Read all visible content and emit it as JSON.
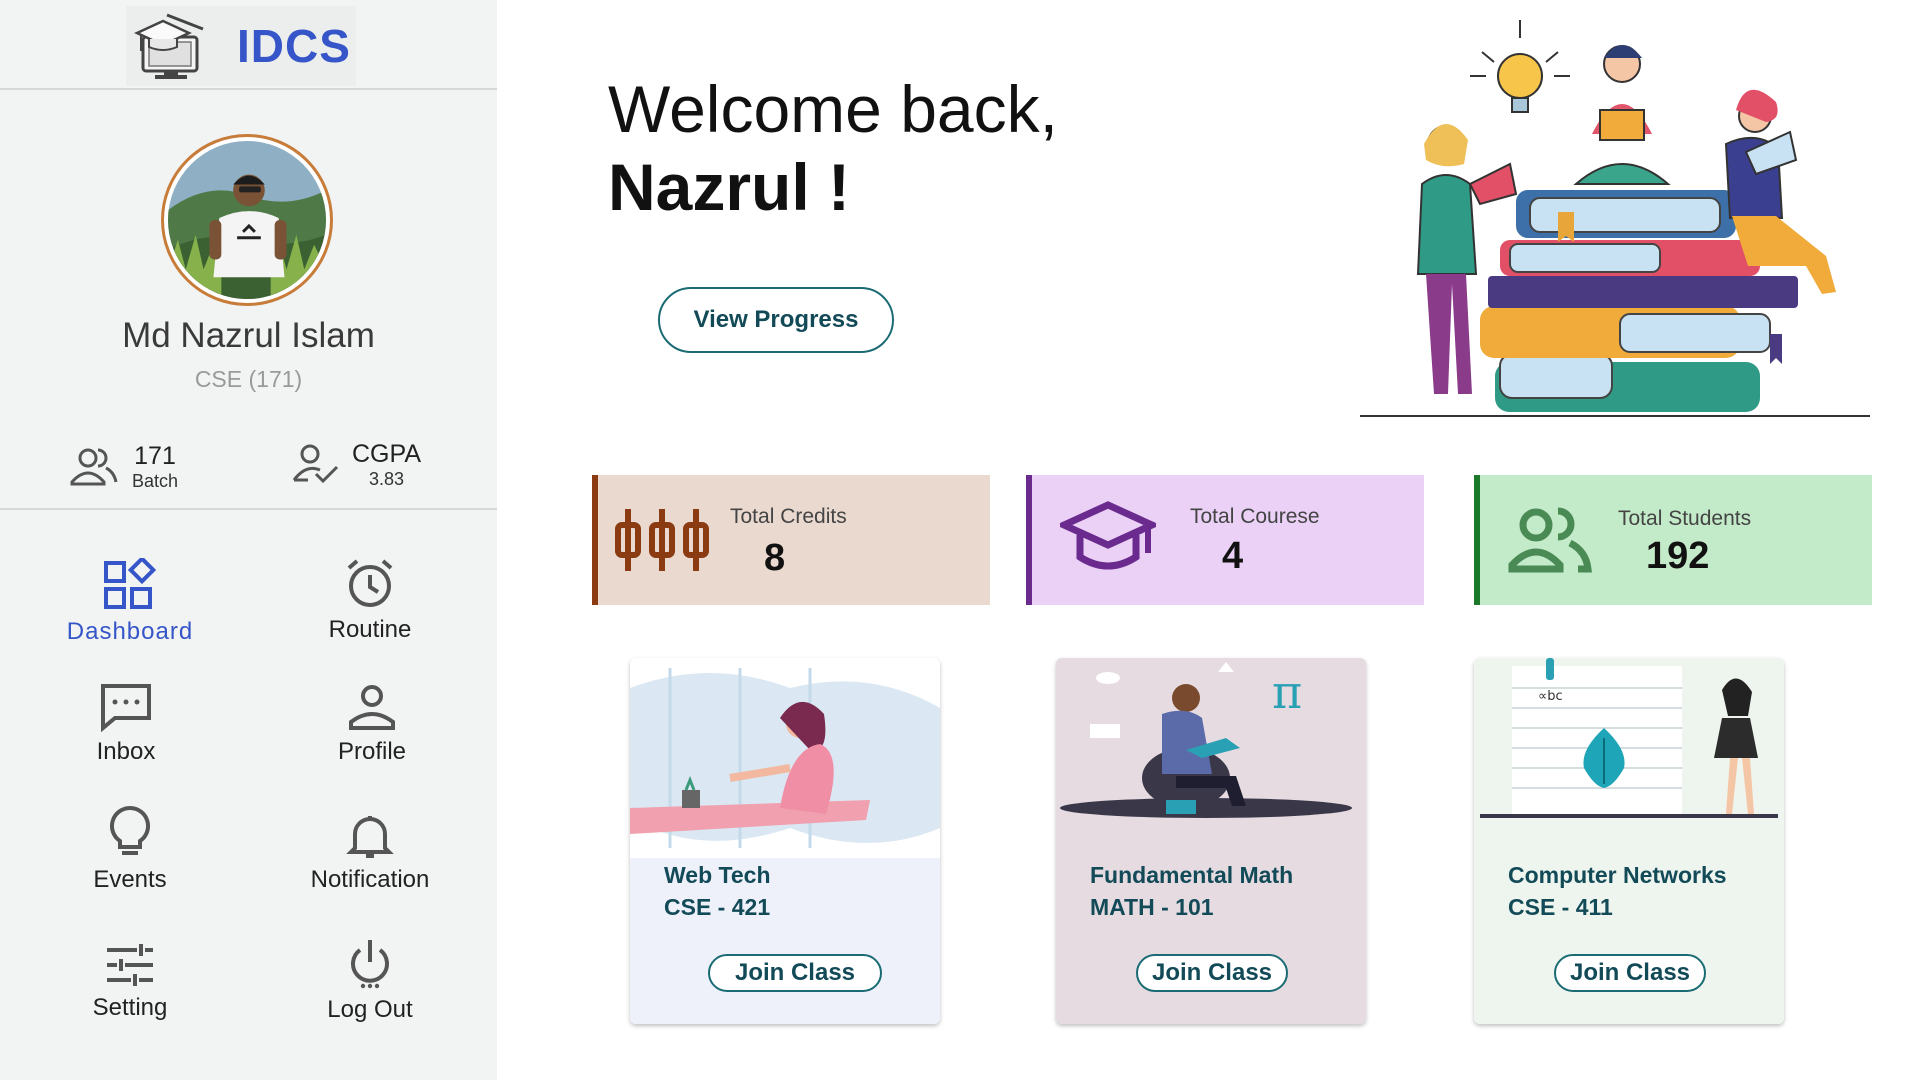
{
  "brand": {
    "name": "IDCS"
  },
  "user": {
    "name": "Md Nazrul Islam",
    "dept": "CSE (171)"
  },
  "stats": {
    "batch_value": "171",
    "batch_label": "Batch",
    "cgpa_label": "CGPA",
    "cgpa_value": "3.83"
  },
  "nav": [
    {
      "label": "Dashboard",
      "icon": "dashboard-icon",
      "active": true
    },
    {
      "label": "Routine",
      "icon": "alarm-clock-icon"
    },
    {
      "label": "Inbox",
      "icon": "chat-icon"
    },
    {
      "label": "Profile",
      "icon": "person-icon"
    },
    {
      "label": "Events",
      "icon": "lightbulb-icon"
    },
    {
      "label": "Notification",
      "icon": "bell-icon"
    },
    {
      "label": "Setting",
      "icon": "sliders-icon"
    },
    {
      "label": "Log Out",
      "icon": "power-icon"
    }
  ],
  "welcome": {
    "line1": "Welcome back,",
    "line2": "Nazrul !"
  },
  "progress_button": "View Progress",
  "summary": [
    {
      "title": "Total  Credits",
      "value": "8",
      "color": "#ead9cf",
      "accent": "#8a3b12",
      "icon": "credits-icon"
    },
    {
      "title": "Total Courese",
      "value": "4",
      "color": "#ead1f5",
      "accent": "#6a2a8e",
      "icon": "graduation-cap-icon"
    },
    {
      "title": "Total Students",
      "value": "192",
      "color": "#c4ebc9",
      "accent": "#1a7a2a",
      "icon": "users-icon"
    }
  ],
  "courses": [
    {
      "title": "Web Tech",
      "code": "CSE - 421",
      "button": "Join Class",
      "bg": "#eef1fa"
    },
    {
      "title": "Fundamental Math",
      "code": "MATH - 101",
      "button": "Join Class",
      "bg": "#e5dbe1"
    },
    {
      "title": "Computer Networks",
      "code": "CSE - 411",
      "button": "Join Class",
      "bg": "#edf5ee"
    }
  ],
  "colors": {
    "brand": "#3555c8",
    "primary_dark": "#134a58",
    "sidebar_bg": "#f2f3f3"
  }
}
